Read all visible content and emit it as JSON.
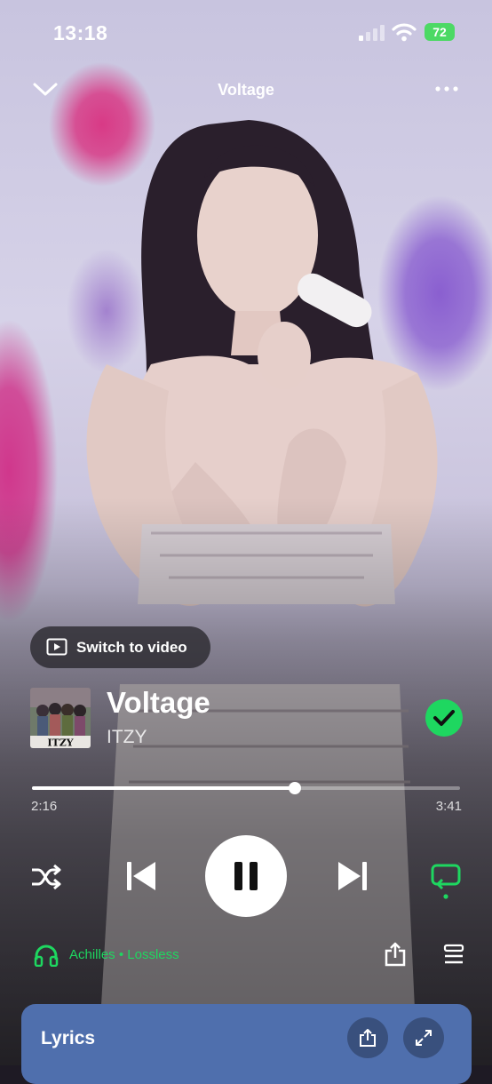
{
  "status_bar": {
    "time": "13:18",
    "battery": "72"
  },
  "header": {
    "title": "Voltage"
  },
  "video_toggle": {
    "label": "Switch to video"
  },
  "track": {
    "title": "Voltage",
    "artist": "ITZY",
    "album_art_text": "ITZY"
  },
  "progress": {
    "elapsed": "2:16",
    "total": "3:41",
    "fraction": 0.615
  },
  "device": {
    "label": "Achilles • Lossless"
  },
  "lyrics": {
    "label": "Lyrics"
  },
  "colors": {
    "accent_green": "#1ed760",
    "lyrics_card": "#4f6fad"
  },
  "icons": [
    "chevron-down-icon",
    "more-icon",
    "video-icon",
    "check-icon",
    "shuffle-icon",
    "previous-icon",
    "pause-icon",
    "next-icon",
    "repeat-icon",
    "headphones-icon",
    "share-icon",
    "queue-icon",
    "expand-icon"
  ]
}
